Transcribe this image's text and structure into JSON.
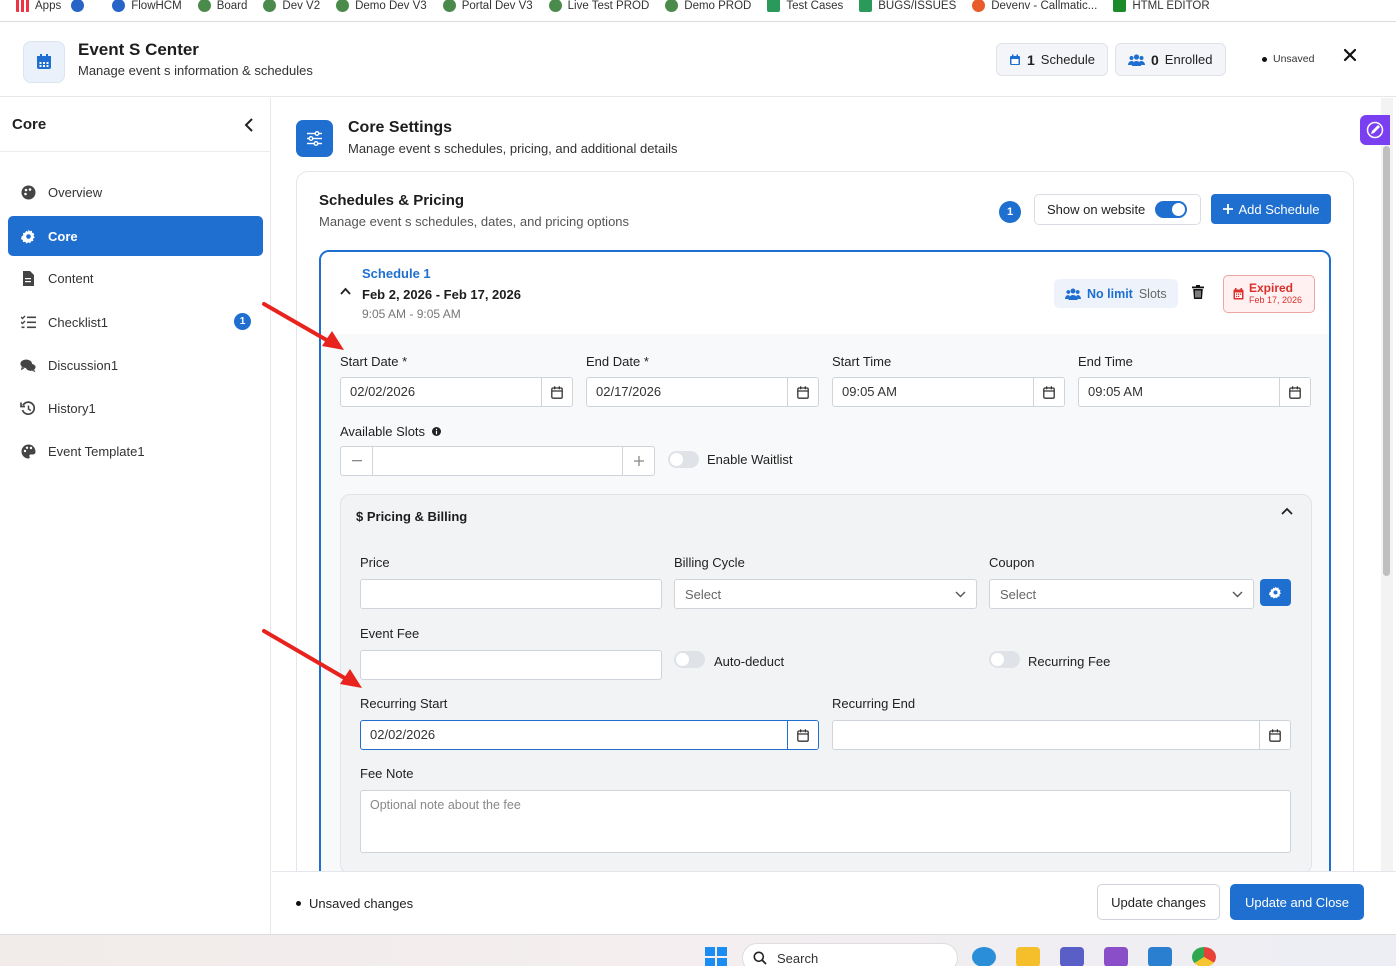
{
  "bookmarks": [
    "Apps",
    "FlowHCM",
    "Board",
    "Dev V2",
    "Demo Dev V3",
    "Portal Dev V3",
    "Live Test PROD",
    "Demo PROD",
    "Test Cases",
    "BUGS/ISSUES",
    "Devenv - Callmatic...",
    "HTML EDITOR"
  ],
  "header": {
    "title": "Event S Center",
    "subtitle": "Manage event s information & schedules",
    "schedule_count": "1",
    "schedule_label": "Schedule",
    "enrolled_count": "0",
    "enrolled_label": "Enrolled",
    "status": "Unsaved"
  },
  "sidebar": {
    "title": "Core",
    "items": [
      {
        "label": "Overview",
        "icon": "palette-icon"
      },
      {
        "label": "Core",
        "icon": "gear-icon",
        "active": true
      },
      {
        "label": "Content",
        "icon": "file-icon"
      },
      {
        "label": "Checklist1",
        "icon": "checklist-icon",
        "badge": "1"
      },
      {
        "label": "Discussion1",
        "icon": "comments-icon"
      },
      {
        "label": "History1",
        "icon": "history-icon"
      },
      {
        "label": "Event Template1",
        "icon": "palette-icon"
      }
    ]
  },
  "core_settings": {
    "title": "Core Settings",
    "subtitle": "Manage event s schedules, pricing, and additional details"
  },
  "schedules": {
    "title": "Schedules & Pricing",
    "subtitle": "Manage event s schedules, dates, and pricing options",
    "count": "1",
    "show_on_website": "Show on website",
    "add_button": "Add Schedule"
  },
  "schedule1": {
    "name": "Schedule 1",
    "dates": "Feb 2, 2026 - Feb 17, 2026",
    "times": "9:05 AM - 9:05 AM",
    "slots_value": "No limit",
    "slots_label": "Slots",
    "status": "Expired",
    "status_date": "Feb 17, 2026",
    "start_date_label": "Start Date *",
    "start_date": "02/02/2026",
    "end_date_label": "End Date *",
    "end_date": "02/17/2026",
    "start_time_label": "Start Time",
    "start_time": "09:05 AM",
    "end_time_label": "End Time",
    "end_time": "09:05 AM",
    "available_slots_label": "Available Slots",
    "waitlist_label": "Enable Waitlist"
  },
  "pricing": {
    "title": "Pricing & Billing",
    "price_label": "Price",
    "billing_label": "Billing Cycle",
    "billing_value": "Select",
    "coupon_label": "Coupon",
    "coupon_value": "Select",
    "event_fee_label": "Event Fee",
    "auto_deduct_label": "Auto-deduct",
    "recurring_fee_label": "Recurring Fee",
    "recurring_start_label": "Recurring Start",
    "recurring_start": "02/02/2026",
    "recurring_end_label": "Recurring End",
    "fee_note_label": "Fee Note",
    "fee_note_placeholder": "Optional note about the fee"
  },
  "footer": {
    "status": "Unsaved changes",
    "update": "Update changes",
    "update_close": "Update and Close"
  },
  "taskbar": {
    "search": "Search"
  },
  "colors": {
    "accent": "#1e6fd0",
    "danger": "#d9302c",
    "annotation": "#e8231d"
  }
}
